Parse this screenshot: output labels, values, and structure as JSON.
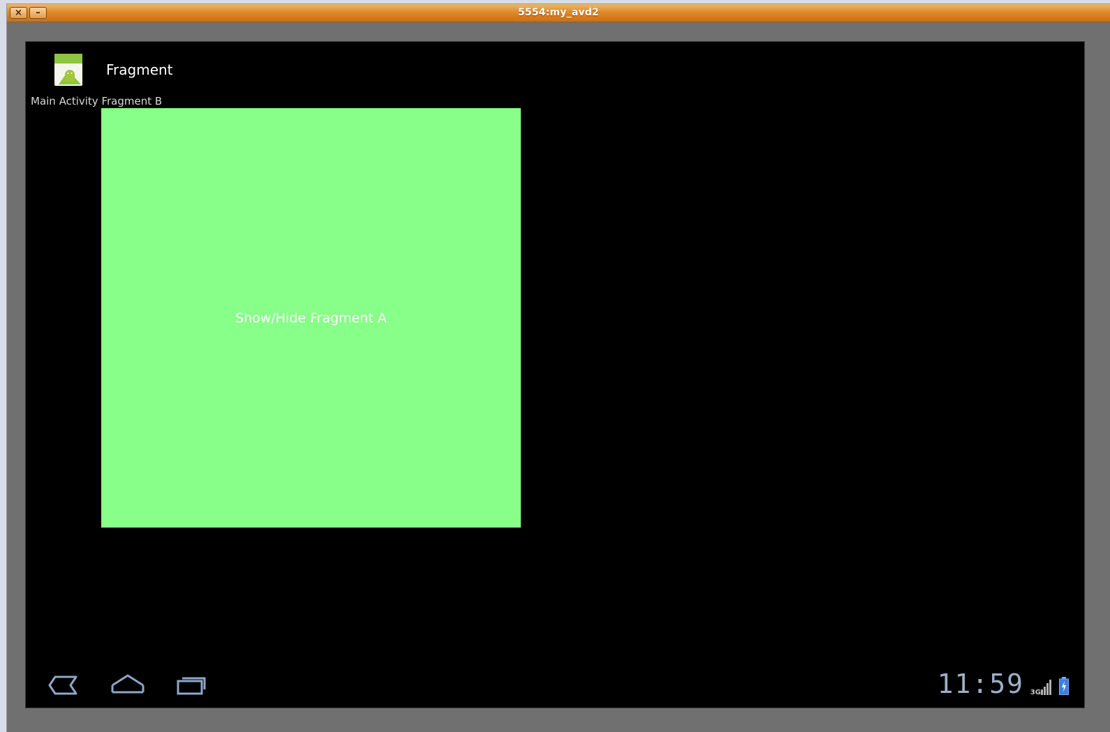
{
  "window": {
    "title": "5554:my_avd2",
    "close_glyph": "×",
    "minimize_glyph": "–"
  },
  "app": {
    "title": "Fragment",
    "icon": "android-app-icon"
  },
  "content": {
    "main_label": "Main Activity Fragment B",
    "fragment_button_label": "Show/Hide Fragment A",
    "fragment_color": "#88ff88"
  },
  "status_bar": {
    "time": "11:59",
    "network": "3G"
  },
  "navigation": {
    "buttons": [
      "back-icon",
      "home-icon",
      "recent-apps-icon"
    ]
  }
}
